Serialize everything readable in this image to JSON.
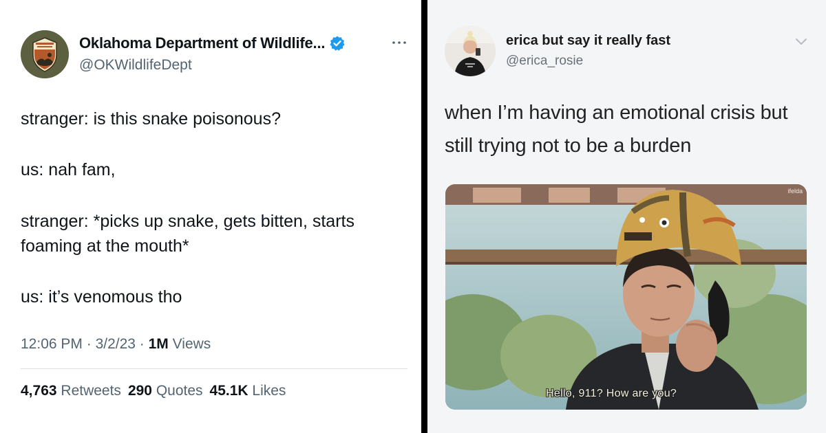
{
  "left_tweet": {
    "display_name": "Oklahoma Department of Wildlife...",
    "handle": "@OKWildlifeDept",
    "avatar_icon": "odwc-badge-icon",
    "verified_icon": "verified-badge-icon",
    "more_icon": "more-options-icon",
    "lines": [
      "stranger: is this snake poisonous?",
      "us: nah fam,",
      "stranger: *picks up snake, gets bitten, starts",
      "foaming at the mouth*",
      "us: it’s venomous tho"
    ],
    "meta": {
      "time": "12:06 PM",
      "sep1": " · ",
      "date": "3/2/23",
      "sep2": " · ",
      "views_count": "1M",
      "views_label": " Views"
    },
    "stats": {
      "retweets_count": "4,763",
      "retweets_label": " Retweets",
      "quotes_count": "290",
      "quotes_label": " Quotes",
      "likes_count": "45.1K",
      "likes_label": " Likes"
    }
  },
  "right_tweet": {
    "display_name": "erica but say it really fast",
    "handle": "@erica_rosie",
    "chevron_icon": "chevron-down-icon",
    "lines": [
      "when I’m having an emotional crisis but",
      "still trying not to be a burden"
    ],
    "meme_caption": "Hello, 911? How are you?",
    "watermark": "ifelda"
  },
  "colors": {
    "verified_blue": "#1d9bf0",
    "text_primary": "#0f1419",
    "text_secondary": "#536471",
    "divider": "#000000"
  }
}
